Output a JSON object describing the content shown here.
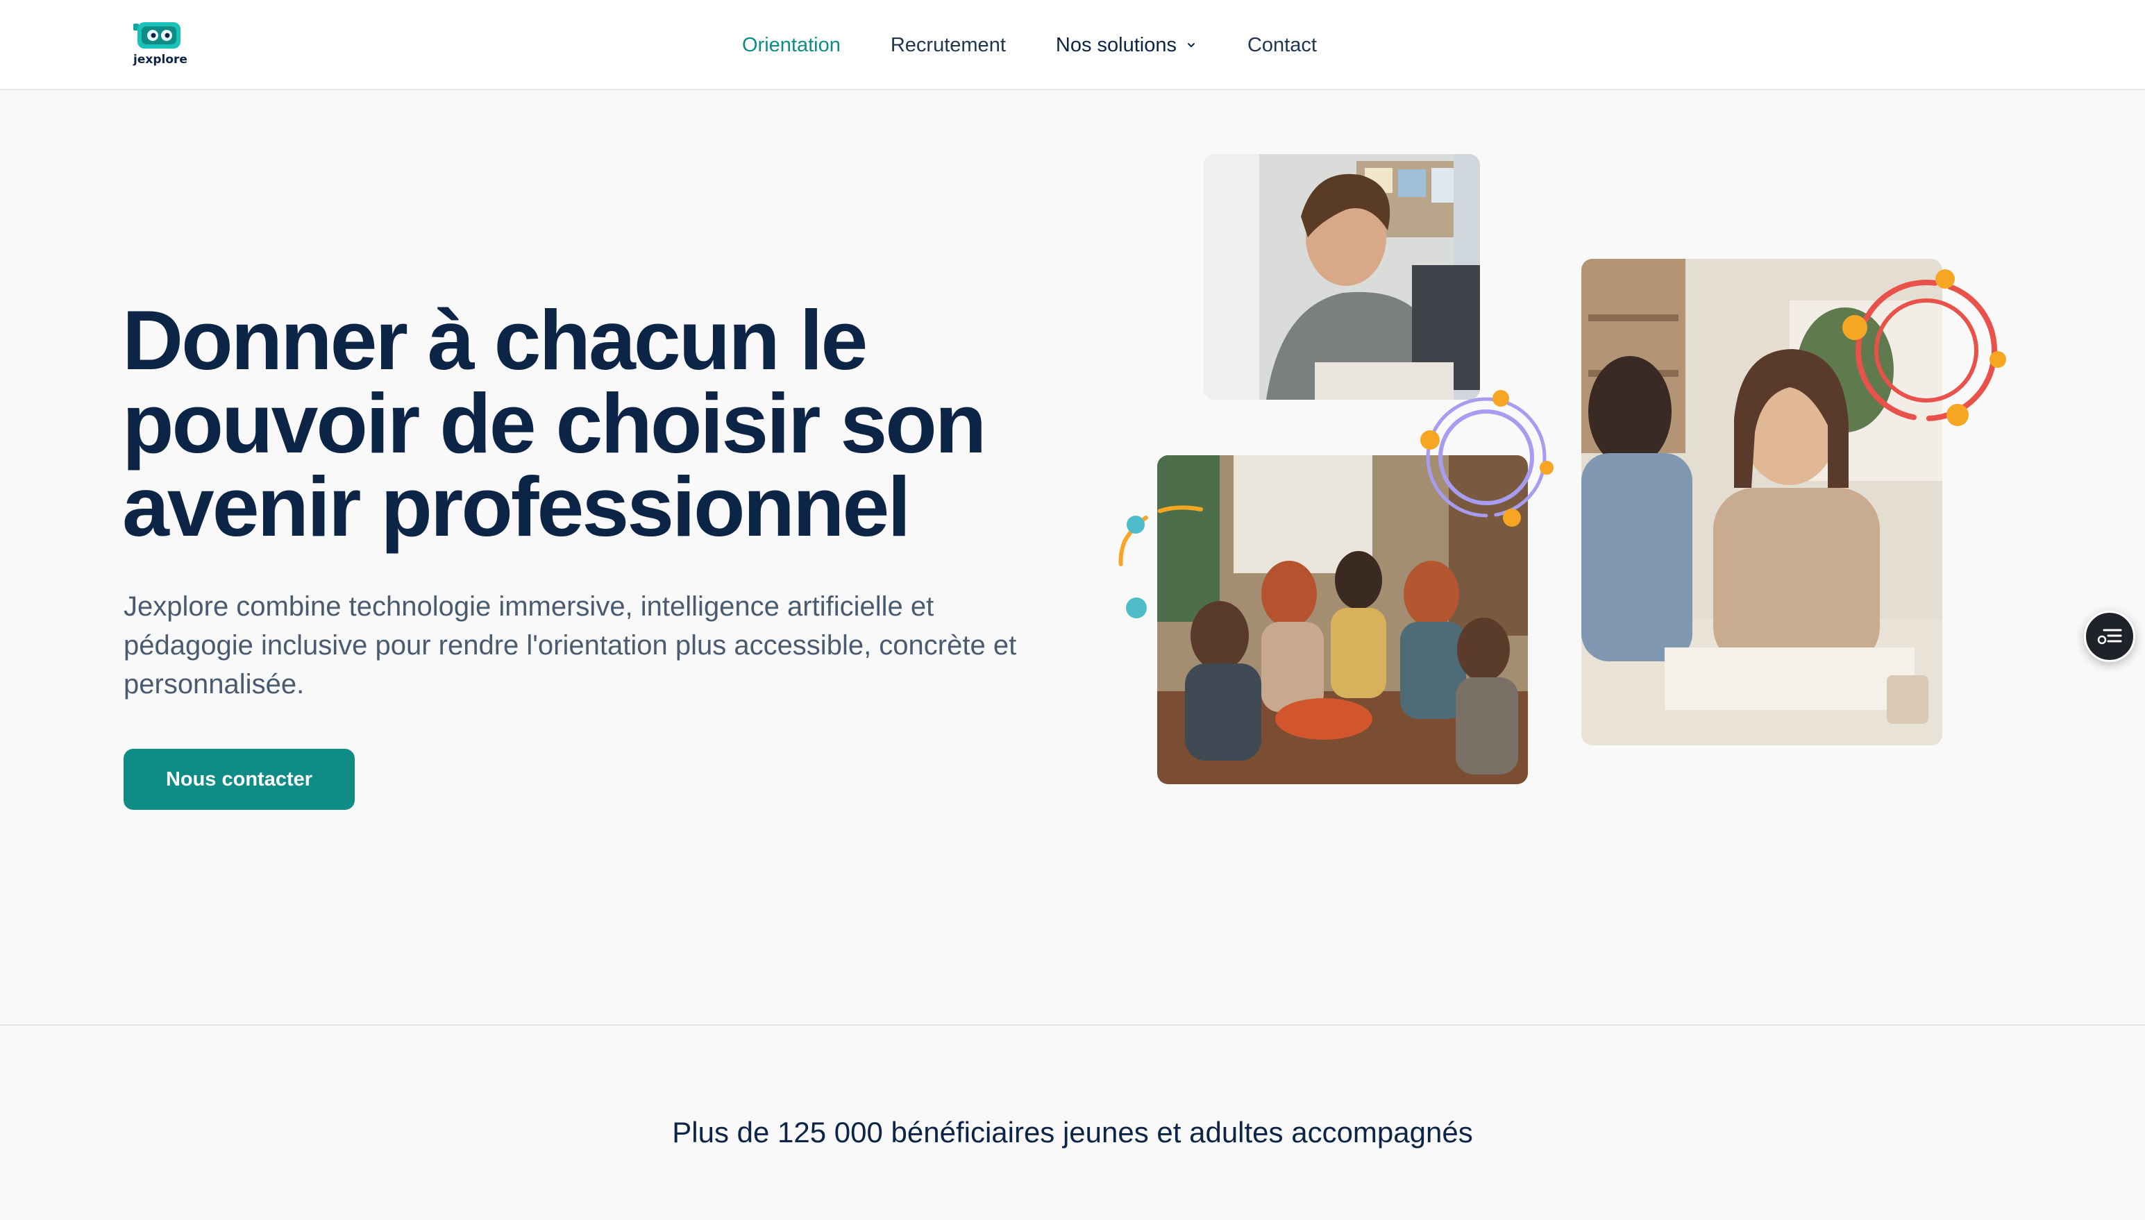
{
  "brand": {
    "logo_text": "jexplore",
    "logo_icon": "vr-headset-icon"
  },
  "nav": {
    "items": [
      {
        "label": "Orientation",
        "active": true
      },
      {
        "label": "Recrutement",
        "active": false
      },
      {
        "label": "Nos solutions",
        "active": false,
        "has_dropdown": true
      },
      {
        "label": "Contact",
        "active": false
      }
    ]
  },
  "hero": {
    "title": "Donner à chacun le pouvoir de choisir son avenir professionnel",
    "subtitle": "Jexplore combine technologie immersive, intelligence artificielle et pédagogie inclusive pour rendre l'orientation plus accessible, concrète et personnalisée.",
    "cta_label": "Nous contacter"
  },
  "stats": {
    "text": "Plus de 125 000 bénéficiaires jeunes et adultes accompagnés"
  },
  "colors": {
    "primary": "#0f8c86",
    "navy": "#0c2445",
    "accent_orange": "#f6a623",
    "accent_red": "#e9524a",
    "accent_purple": "#a79cf0",
    "accent_teal": "#4fbdc9"
  },
  "icons": {
    "dropdown": "chevron-down-icon",
    "side_widget": "accessibility-menu-icon"
  }
}
